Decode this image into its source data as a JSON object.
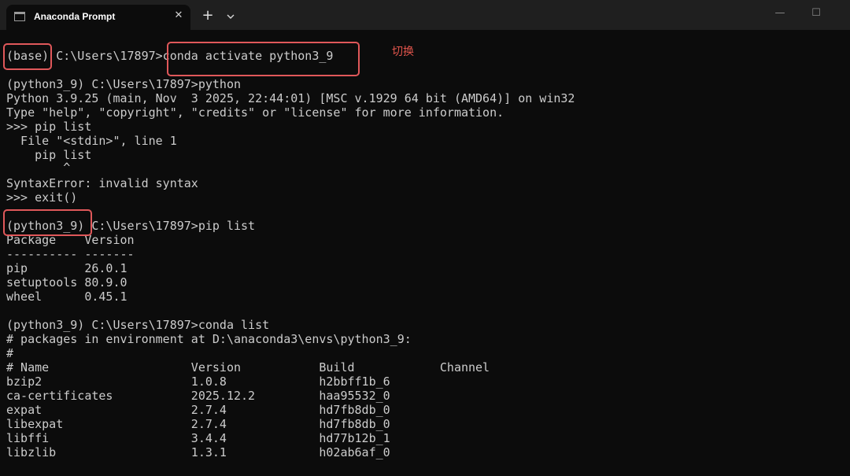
{
  "window": {
    "tab_title": "Anaconda Prompt",
    "tab_close_glyph": "✕",
    "new_tab_glyph": "+",
    "minimize_glyph": "—",
    "maximize_glyph": "☐"
  },
  "annotation": {
    "text": "切换",
    "color": "#e2554c"
  },
  "terminal": {
    "lines": [
      "(base) C:\\Users\\17897>conda activate python3_9",
      "",
      "(python3_9) C:\\Users\\17897>python",
      "Python 3.9.25 (main, Nov  3 2025, 22:44:01) [MSC v.1929 64 bit (AMD64)] on win32",
      "Type \"help\", \"copyright\", \"credits\" or \"license\" for more information.",
      ">>> pip list",
      "  File \"<stdin>\", line 1",
      "    pip list",
      "        ^",
      "SyntaxError: invalid syntax",
      ">>> exit()",
      "",
      "(python3_9) C:\\Users\\17897>pip list",
      "Package    Version",
      "---------- -------",
      "pip        26.0.1",
      "setuptools 80.9.0",
      "wheel      0.45.1",
      "",
      "(python3_9) C:\\Users\\17897>conda list",
      "# packages in environment at D:\\anaconda3\\envs\\python3_9:",
      "#",
      "# Name                    Version           Build            Channel",
      "bzip2                     1.0.8             h2bbff1b_6",
      "ca-certificates           2025.12.2         haa95532_0",
      "expat                     2.7.4             hd7fb8db_0",
      "libexpat                  2.7.4             hd7fb8db_0",
      "libffi                    3.4.4             hd77b12b_1",
      "libzlib                   1.3.1             h02ab6af_0"
    ]
  }
}
